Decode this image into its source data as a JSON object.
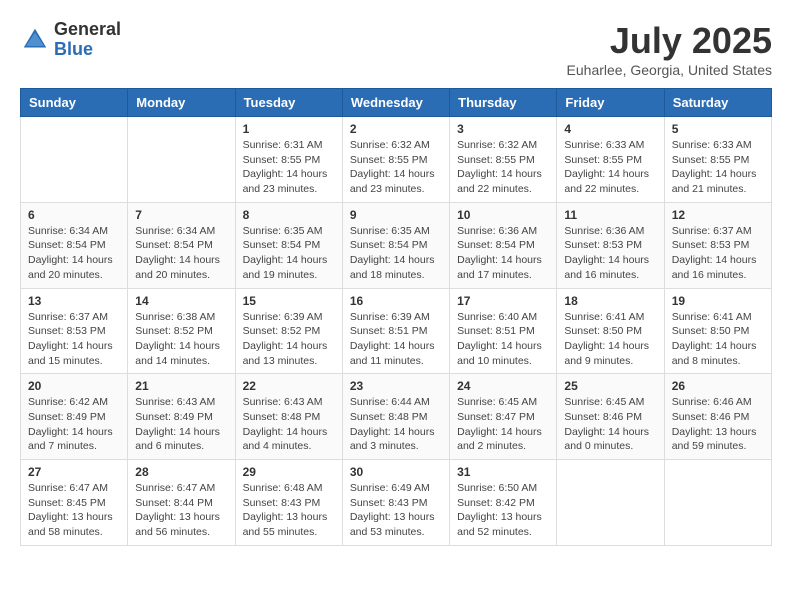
{
  "header": {
    "logo_general": "General",
    "logo_blue": "Blue",
    "month_title": "July 2025",
    "location": "Euharlee, Georgia, United States"
  },
  "weekdays": [
    "Sunday",
    "Monday",
    "Tuesday",
    "Wednesday",
    "Thursday",
    "Friday",
    "Saturday"
  ],
  "weeks": [
    [
      {
        "day": "",
        "info": ""
      },
      {
        "day": "",
        "info": ""
      },
      {
        "day": "1",
        "info": "Sunrise: 6:31 AM\nSunset: 8:55 PM\nDaylight: 14 hours and 23 minutes."
      },
      {
        "day": "2",
        "info": "Sunrise: 6:32 AM\nSunset: 8:55 PM\nDaylight: 14 hours and 23 minutes."
      },
      {
        "day": "3",
        "info": "Sunrise: 6:32 AM\nSunset: 8:55 PM\nDaylight: 14 hours and 22 minutes."
      },
      {
        "day": "4",
        "info": "Sunrise: 6:33 AM\nSunset: 8:55 PM\nDaylight: 14 hours and 22 minutes."
      },
      {
        "day": "5",
        "info": "Sunrise: 6:33 AM\nSunset: 8:55 PM\nDaylight: 14 hours and 21 minutes."
      }
    ],
    [
      {
        "day": "6",
        "info": "Sunrise: 6:34 AM\nSunset: 8:54 PM\nDaylight: 14 hours and 20 minutes."
      },
      {
        "day": "7",
        "info": "Sunrise: 6:34 AM\nSunset: 8:54 PM\nDaylight: 14 hours and 20 minutes."
      },
      {
        "day": "8",
        "info": "Sunrise: 6:35 AM\nSunset: 8:54 PM\nDaylight: 14 hours and 19 minutes."
      },
      {
        "day": "9",
        "info": "Sunrise: 6:35 AM\nSunset: 8:54 PM\nDaylight: 14 hours and 18 minutes."
      },
      {
        "day": "10",
        "info": "Sunrise: 6:36 AM\nSunset: 8:54 PM\nDaylight: 14 hours and 17 minutes."
      },
      {
        "day": "11",
        "info": "Sunrise: 6:36 AM\nSunset: 8:53 PM\nDaylight: 14 hours and 16 minutes."
      },
      {
        "day": "12",
        "info": "Sunrise: 6:37 AM\nSunset: 8:53 PM\nDaylight: 14 hours and 16 minutes."
      }
    ],
    [
      {
        "day": "13",
        "info": "Sunrise: 6:37 AM\nSunset: 8:53 PM\nDaylight: 14 hours and 15 minutes."
      },
      {
        "day": "14",
        "info": "Sunrise: 6:38 AM\nSunset: 8:52 PM\nDaylight: 14 hours and 14 minutes."
      },
      {
        "day": "15",
        "info": "Sunrise: 6:39 AM\nSunset: 8:52 PM\nDaylight: 14 hours and 13 minutes."
      },
      {
        "day": "16",
        "info": "Sunrise: 6:39 AM\nSunset: 8:51 PM\nDaylight: 14 hours and 11 minutes."
      },
      {
        "day": "17",
        "info": "Sunrise: 6:40 AM\nSunset: 8:51 PM\nDaylight: 14 hours and 10 minutes."
      },
      {
        "day": "18",
        "info": "Sunrise: 6:41 AM\nSunset: 8:50 PM\nDaylight: 14 hours and 9 minutes."
      },
      {
        "day": "19",
        "info": "Sunrise: 6:41 AM\nSunset: 8:50 PM\nDaylight: 14 hours and 8 minutes."
      }
    ],
    [
      {
        "day": "20",
        "info": "Sunrise: 6:42 AM\nSunset: 8:49 PM\nDaylight: 14 hours and 7 minutes."
      },
      {
        "day": "21",
        "info": "Sunrise: 6:43 AM\nSunset: 8:49 PM\nDaylight: 14 hours and 6 minutes."
      },
      {
        "day": "22",
        "info": "Sunrise: 6:43 AM\nSunset: 8:48 PM\nDaylight: 14 hours and 4 minutes."
      },
      {
        "day": "23",
        "info": "Sunrise: 6:44 AM\nSunset: 8:48 PM\nDaylight: 14 hours and 3 minutes."
      },
      {
        "day": "24",
        "info": "Sunrise: 6:45 AM\nSunset: 8:47 PM\nDaylight: 14 hours and 2 minutes."
      },
      {
        "day": "25",
        "info": "Sunrise: 6:45 AM\nSunset: 8:46 PM\nDaylight: 14 hours and 0 minutes."
      },
      {
        "day": "26",
        "info": "Sunrise: 6:46 AM\nSunset: 8:46 PM\nDaylight: 13 hours and 59 minutes."
      }
    ],
    [
      {
        "day": "27",
        "info": "Sunrise: 6:47 AM\nSunset: 8:45 PM\nDaylight: 13 hours and 58 minutes."
      },
      {
        "day": "28",
        "info": "Sunrise: 6:47 AM\nSunset: 8:44 PM\nDaylight: 13 hours and 56 minutes."
      },
      {
        "day": "29",
        "info": "Sunrise: 6:48 AM\nSunset: 8:43 PM\nDaylight: 13 hours and 55 minutes."
      },
      {
        "day": "30",
        "info": "Sunrise: 6:49 AM\nSunset: 8:43 PM\nDaylight: 13 hours and 53 minutes."
      },
      {
        "day": "31",
        "info": "Sunrise: 6:50 AM\nSunset: 8:42 PM\nDaylight: 13 hours and 52 minutes."
      },
      {
        "day": "",
        "info": ""
      },
      {
        "day": "",
        "info": ""
      }
    ]
  ]
}
